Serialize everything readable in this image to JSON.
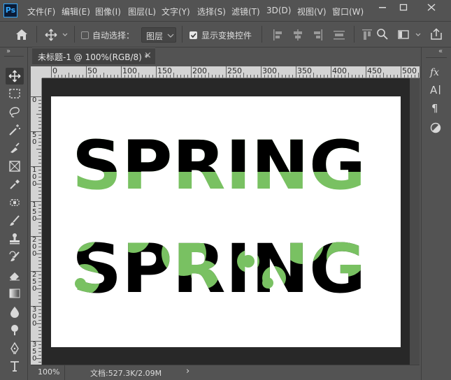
{
  "app": {
    "logo": "Ps"
  },
  "menu": [
    "文件(F)",
    "编辑(E)",
    "图像(I)",
    "图层(L)",
    "文字(Y)",
    "选择(S)",
    "滤镜(T)",
    "3D(D)",
    "视图(V)",
    "窗口(W)"
  ],
  "options": {
    "auto_select_label": "自动选择：",
    "layer_dropdown_value": "图层",
    "show_transform_label": "显示变换控件",
    "auto_select_checked": false,
    "show_transform_checked": true
  },
  "document": {
    "tab_title": "未标题-1 @ 100%(RGB/8) *",
    "tab_close": "×",
    "zoom": "100%",
    "doc_info": "文档:527.3K/2.09M",
    "status_arrow": "›"
  },
  "ruler": {
    "top_labels": [
      "0",
      "50",
      "100",
      "150",
      "200",
      "250",
      "300",
      "350",
      "400",
      "450",
      "500"
    ],
    "left_labels": [
      "0",
      "5 0",
      "1 0 0",
      "1 5 0",
      "2 0 0",
      "2 5 0",
      "3 0 0",
      "3 5 0"
    ]
  },
  "artwork": {
    "text_top": "SPRING",
    "text_bottom": "SPRING",
    "ink_color": "#000000",
    "accent_color": "#79c162",
    "canvas_color": "#ffffff"
  },
  "right_panel": {
    "collapse_glyph": "«",
    "left_collapse_glyph": "»"
  },
  "colors": {
    "ui_bg": "#535353",
    "pasteboard": "#282828",
    "ruler": "#d3d3d3",
    "ps_blue": "#31a8ff"
  }
}
